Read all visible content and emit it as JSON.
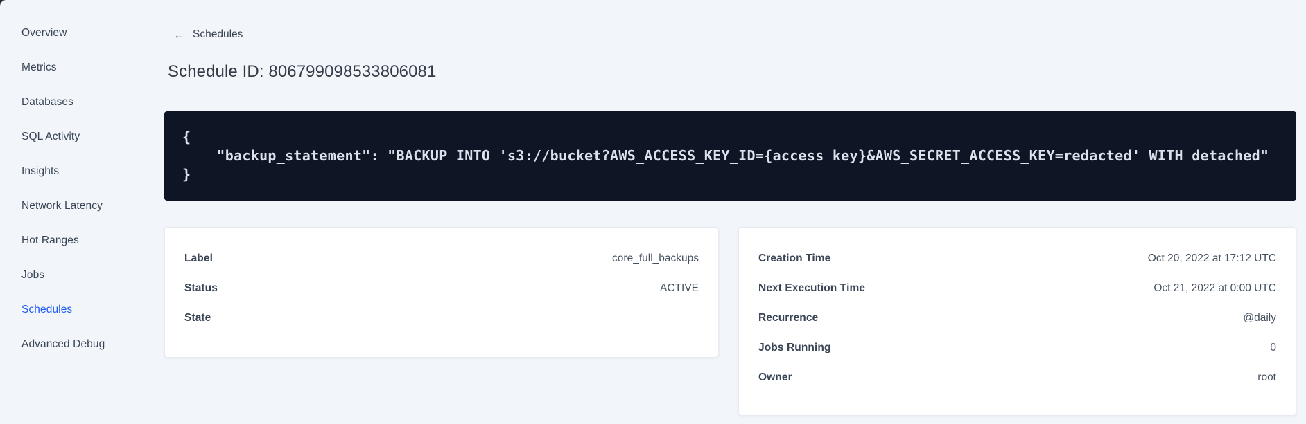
{
  "sidebar": {
    "items": [
      {
        "label": "Overview",
        "active": false
      },
      {
        "label": "Metrics",
        "active": false
      },
      {
        "label": "Databases",
        "active": false
      },
      {
        "label": "SQL Activity",
        "active": false
      },
      {
        "label": "Insights",
        "active": false
      },
      {
        "label": "Network Latency",
        "active": false
      },
      {
        "label": "Hot Ranges",
        "active": false
      },
      {
        "label": "Jobs",
        "active": false
      },
      {
        "label": "Schedules",
        "active": true
      },
      {
        "label": "Advanced Debug",
        "active": false
      }
    ]
  },
  "header": {
    "back_icon": "←",
    "back_label": "Schedules",
    "title": "Schedule ID: 806799098533806081"
  },
  "code_block": {
    "lines": [
      "{",
      "    \"backup_statement\": \"BACKUP INTO 's3://bucket?AWS_ACCESS_KEY_ID={access key}&AWS_SECRET_ACCESS_KEY=redacted' WITH detached\"",
      "}"
    ]
  },
  "details_card": {
    "rows": [
      {
        "label": "Label",
        "value": "core_full_backups"
      },
      {
        "label": "Status",
        "value": "ACTIVE"
      },
      {
        "label": "State",
        "value": ""
      }
    ]
  },
  "schedule_card": {
    "rows": [
      {
        "label": "Creation Time",
        "value": "Oct 20, 2022 at 17:12 UTC"
      },
      {
        "label": "Next Execution Time",
        "value": "Oct 21, 2022 at 0:00 UTC"
      },
      {
        "label": "Recurrence",
        "value": "@daily"
      },
      {
        "label": "Jobs Running",
        "value": "0"
      },
      {
        "label": "Owner",
        "value": "root"
      }
    ]
  },
  "colors": {
    "accent_blue": "#1f5cf5",
    "page_background": "#f2f5f9",
    "code_background": "#0e1626",
    "code_text": "#dce2ec"
  }
}
